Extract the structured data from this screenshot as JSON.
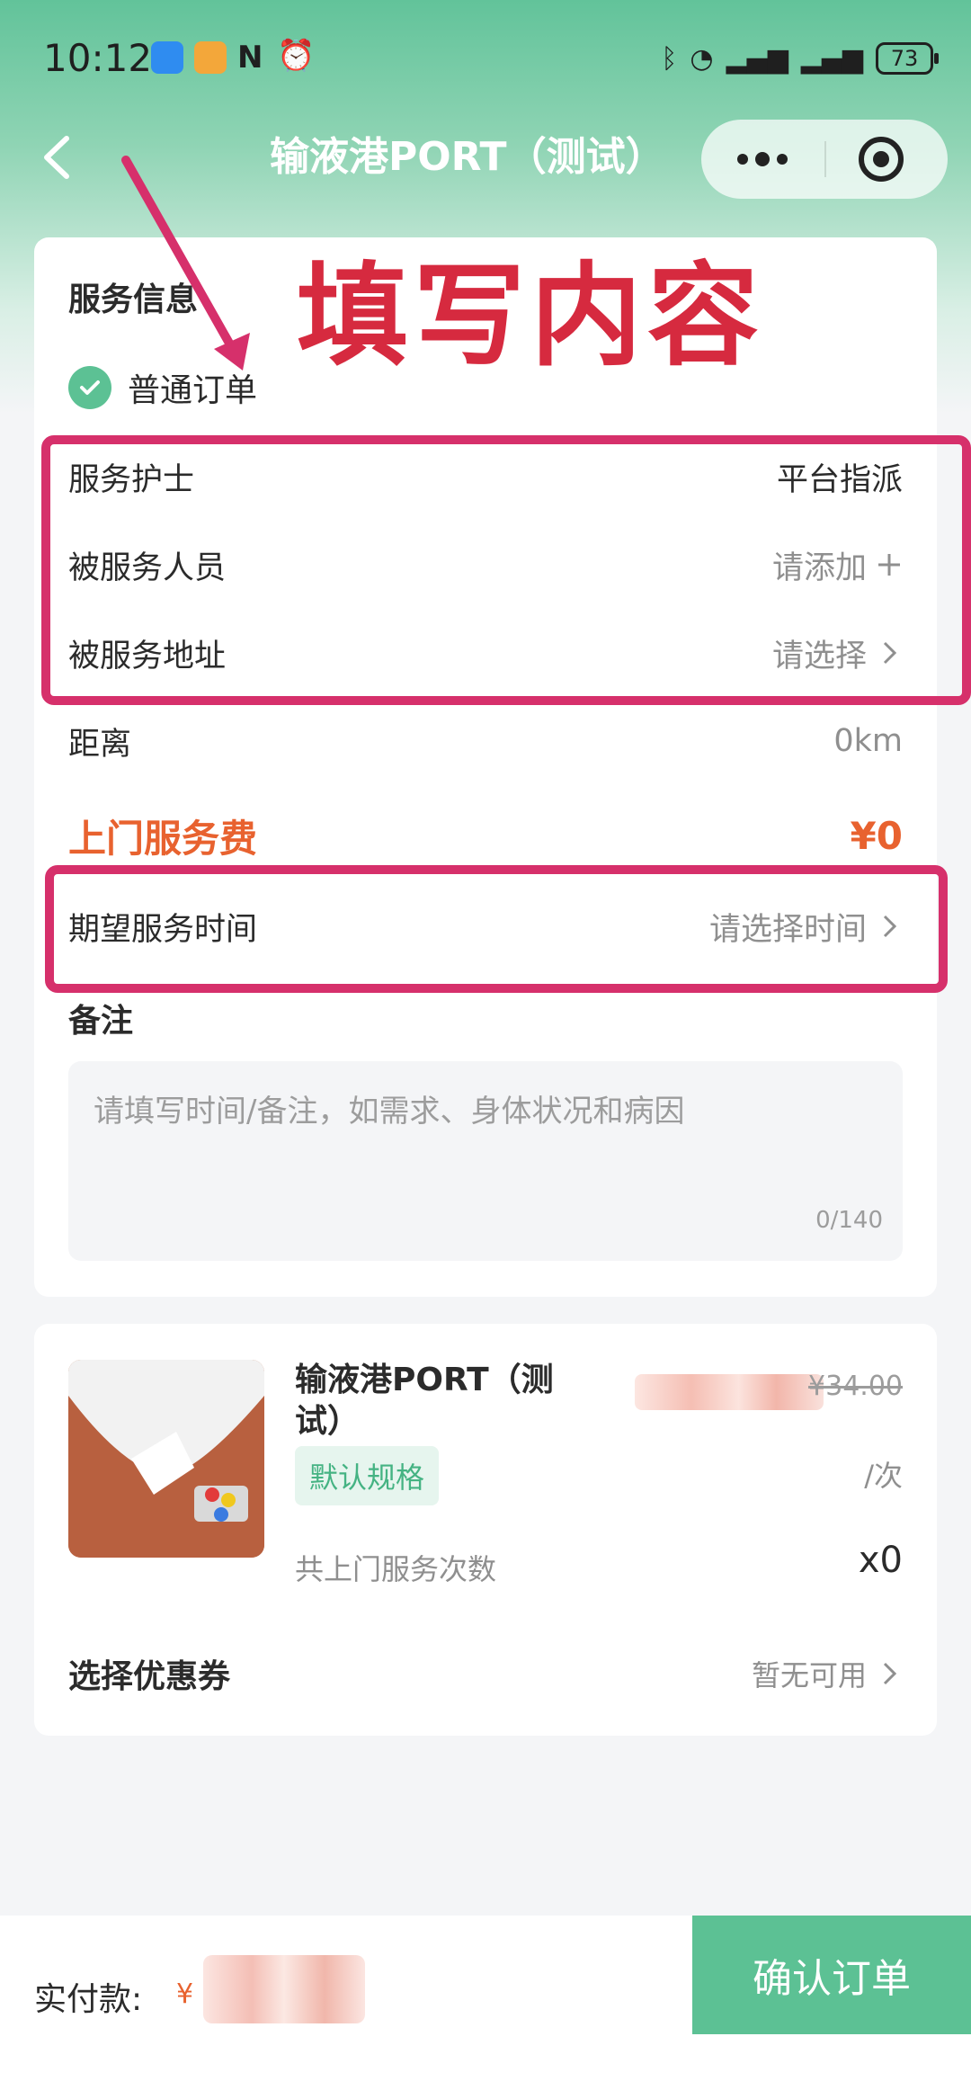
{
  "status_bar": {
    "time": "10:12",
    "battery": "73"
  },
  "nav": {
    "title": "输液港PORT（测试）"
  },
  "service": {
    "section_title": "服务信息",
    "order_type": "普通订单",
    "nurse_label": "服务护士",
    "nurse_value": "平台指派",
    "person_label": "被服务人员",
    "person_value": "请添加",
    "address_label": "被服务地址",
    "address_value": "请选择",
    "distance_label": "距离",
    "distance_value": "0km",
    "fee_label": "上门服务费",
    "fee_value": "¥0",
    "time_label": "期望服务时间",
    "time_value": "请选择时间",
    "remark_label": "备注",
    "remark_placeholder": "请填写时间/备注，如需求、身体状况和病因",
    "remark_count": "0/140"
  },
  "product": {
    "name": "输液港PORT（测试）",
    "original_price": "¥34.00",
    "spec": "默认规格",
    "per": "/次",
    "times_label": "共上门服务次数",
    "times_value": "x0",
    "coupon_label": "选择优惠券",
    "coupon_value": "暂无可用"
  },
  "footer": {
    "pay_label": "实付款:",
    "pay_symbol": "¥",
    "confirm_label": "确认订单"
  },
  "annotation": {
    "text": "填写内容"
  },
  "colors": {
    "accent": "#5cc194",
    "price": "#e8622f",
    "annotation": "#d6306b"
  }
}
